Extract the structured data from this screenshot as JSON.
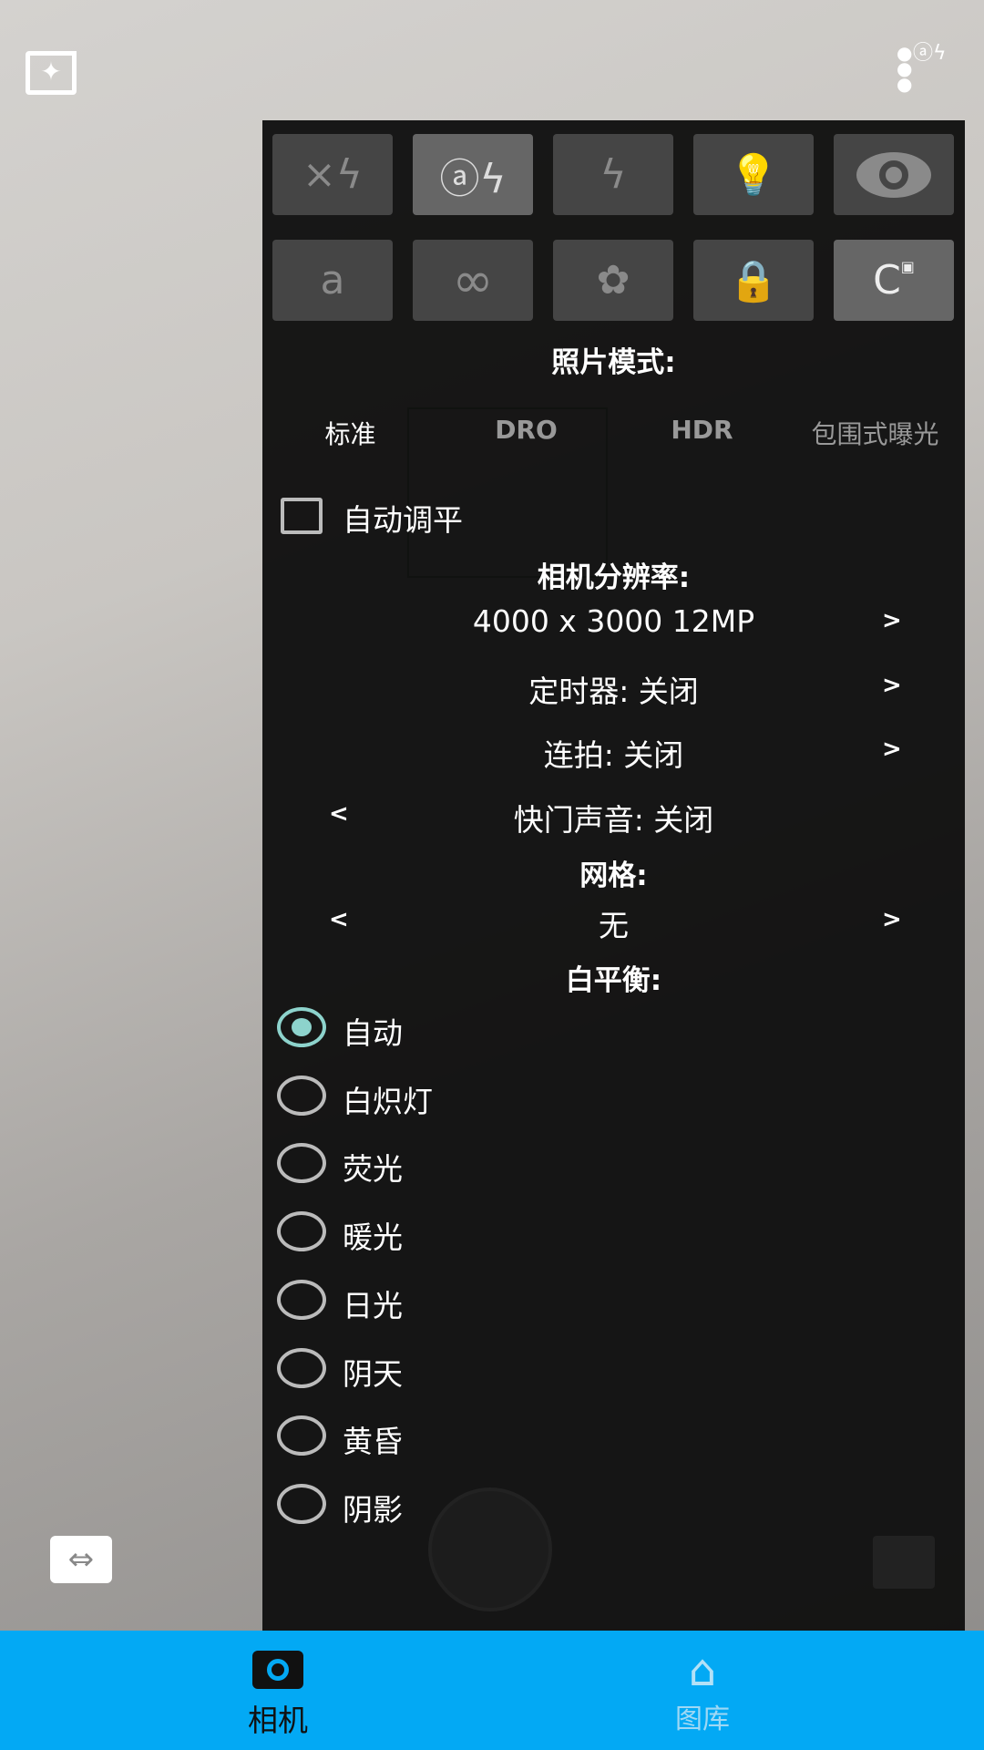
{
  "top": {
    "left_icon": "sparkle-frame-icon",
    "right_icon": "more-vert-flash-auto-icon"
  },
  "panel": {
    "row1": [
      {
        "icon": "flash-off-icon",
        "sel": false
      },
      {
        "icon": "flash-auto-icon",
        "sel": true
      },
      {
        "icon": "flash-on-icon",
        "sel": false
      },
      {
        "icon": "torch-bulb-icon",
        "sel": false
      },
      {
        "icon": "red-eye-icon",
        "sel": false
      }
    ],
    "row2": [
      {
        "icon": "focus-auto-icon",
        "label": "a",
        "sel": false
      },
      {
        "icon": "focus-infinity-icon",
        "label": "∞",
        "sel": false
      },
      {
        "icon": "focus-macro-icon",
        "sel": false
      },
      {
        "icon": "focus-locked-icon",
        "sel": false
      },
      {
        "icon": "focus-continuous-icon",
        "label": "C",
        "sel": true
      }
    ],
    "photo_mode_title": "照片模式:",
    "modes": [
      {
        "label": "标准",
        "active": true
      },
      {
        "label": "DRO",
        "active": false
      },
      {
        "label": "HDR",
        "active": false
      },
      {
        "label": "包围式曝光",
        "active": false
      }
    ],
    "auto_level": {
      "label": "自动调平",
      "checked": false
    },
    "resolution_title": "相机分辨率:",
    "resolution": "4000 x 3000 12MP",
    "timer": "定时器: 关闭",
    "burst": "连拍: 关闭",
    "shutter_sound": "快门声音: 关闭",
    "grid_title": "网格:",
    "grid": "无",
    "wb_title": "白平衡:",
    "wb_options": [
      "自动",
      "白炽灯",
      "荧光",
      "暖光",
      "日光",
      "阴天",
      "黄昏",
      "阴影"
    ],
    "wb_selected": "自动",
    "arrow_right": ">",
    "arrow_left": "<"
  },
  "nav": {
    "items": [
      {
        "label": "相机",
        "icon": "camera-icon",
        "active": true
      },
      {
        "label": "图库",
        "icon": "home-icon",
        "active": false
      }
    ]
  },
  "colors": {
    "nav_bg": "#03a9f4",
    "radio_accent": "#8dd3cc"
  }
}
